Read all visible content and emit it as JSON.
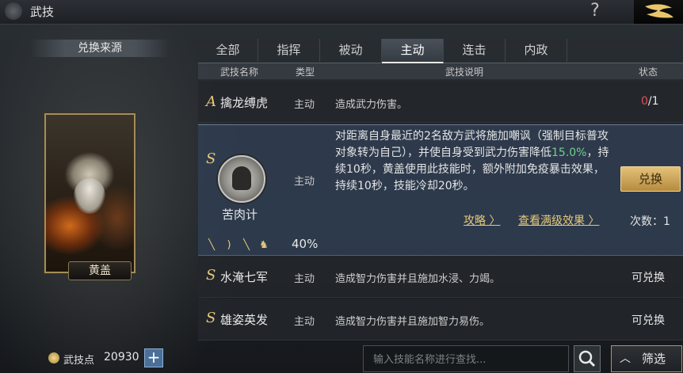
{
  "window": {
    "title": "武技",
    "help_glyph": "?"
  },
  "sidebar": {
    "source_title": "兑换来源",
    "general_name": "黄盖"
  },
  "tabs": [
    {
      "label": "全部"
    },
    {
      "label": "指挥"
    },
    {
      "label": "被动"
    },
    {
      "label": "主动",
      "active": true
    },
    {
      "label": "连击"
    },
    {
      "label": "内政"
    }
  ],
  "table": {
    "headers": {
      "name": "武技名称",
      "type": "类型",
      "desc": "武技说明",
      "status": "状态"
    },
    "rows": [
      {
        "grade": "A",
        "name": "擒龙缚虎",
        "type": "主动",
        "desc": "造成武力伤害。",
        "status_owned": "0",
        "status_total": "/1"
      },
      {
        "grade": "S",
        "name": "水淹七军",
        "type": "主动",
        "desc": "造成智力伤害并且施加水浸、力竭。",
        "status": "可兑换"
      },
      {
        "grade": "S",
        "name": "雄姿英发",
        "type": "主动",
        "desc": "造成智力伤害并且施加智力易伤。",
        "status": "可兑换"
      }
    ],
    "expanded": {
      "grade": "S",
      "name": "苦肉计",
      "type": "主动",
      "desc_part1": "对距离自身最近的2名敌方武将施加嘲讽（强制目标普攻对象转为自己），并使自身受到武力伤害降低",
      "desc_highlight": "15.0%",
      "desc_part2": "，持续10秒，黄盖使用此技能时，额外附加免疫暴击效果，持续10秒，技能冷却20秒。",
      "guide_link": "攻略 〉",
      "max_effect_link": "查看满级效果 〉",
      "exchange_label": "兑换",
      "count_text": "次数：1",
      "percent": "40%",
      "icon_name": "taunt-warrior-icon",
      "weapon_icons": [
        "sword-icon",
        "bow-icon",
        "spear-icon",
        "horse-icon"
      ]
    }
  },
  "footer": {
    "points_label": "武技点",
    "points_value": "20930",
    "plus_glyph": "+",
    "search_placeholder": "输入技能名称进行查找...",
    "filter_label": "筛选",
    "filter_chevron": "︿"
  },
  "colors": {
    "accent_gold": "#e6c97a",
    "highlight_green": "#6fd08a",
    "status_red": "#e05050"
  }
}
